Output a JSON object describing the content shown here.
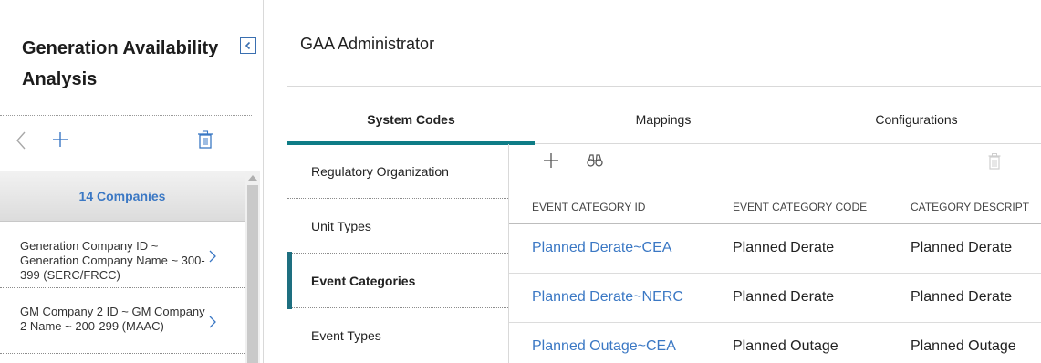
{
  "sidebar": {
    "title": "Generation Availability Analysis",
    "companies_header": "14 Companies",
    "companies": [
      {
        "label": "Generation Company ID ~ Generation Company Name ~ 300-399 (SERC/FRCC)"
      },
      {
        "label": "GM Company 2 ID ~ GM Company 2 Name ~ 200-299 (MAAC)"
      }
    ]
  },
  "main": {
    "title": "GAA Administrator",
    "tabs": [
      {
        "label": "System Codes",
        "active": true
      },
      {
        "label": "Mappings"
      },
      {
        "label": "Configurations"
      }
    ],
    "categories": [
      {
        "label": "Regulatory Organization"
      },
      {
        "label": "Unit Types"
      },
      {
        "label": "Event Categories",
        "active": true
      },
      {
        "label": "Event Types"
      }
    ],
    "grid": {
      "columns": [
        "EVENT CATEGORY ID",
        "EVENT CATEGORY CODE",
        "CATEGORY DESCRIPT"
      ],
      "rows": [
        [
          "Planned Derate~CEA",
          "Planned Derate",
          "Planned Derate"
        ],
        [
          "Planned Derate~NERC",
          "Planned Derate",
          "Planned Derate"
        ],
        [
          "Planned Outage~CEA",
          "Planned Outage",
          "Planned Outage"
        ]
      ]
    }
  },
  "colors": {
    "accent": "#0e7c86",
    "link": "#3b78c4",
    "active_marker": "#1e6f80"
  },
  "icons": {
    "collapse": "chevron-left-box-icon",
    "back": "chevron-left-icon",
    "add": "plus-icon",
    "delete": "trash-icon",
    "search": "binoculars-icon",
    "list_item": "chevron-right-icon"
  }
}
